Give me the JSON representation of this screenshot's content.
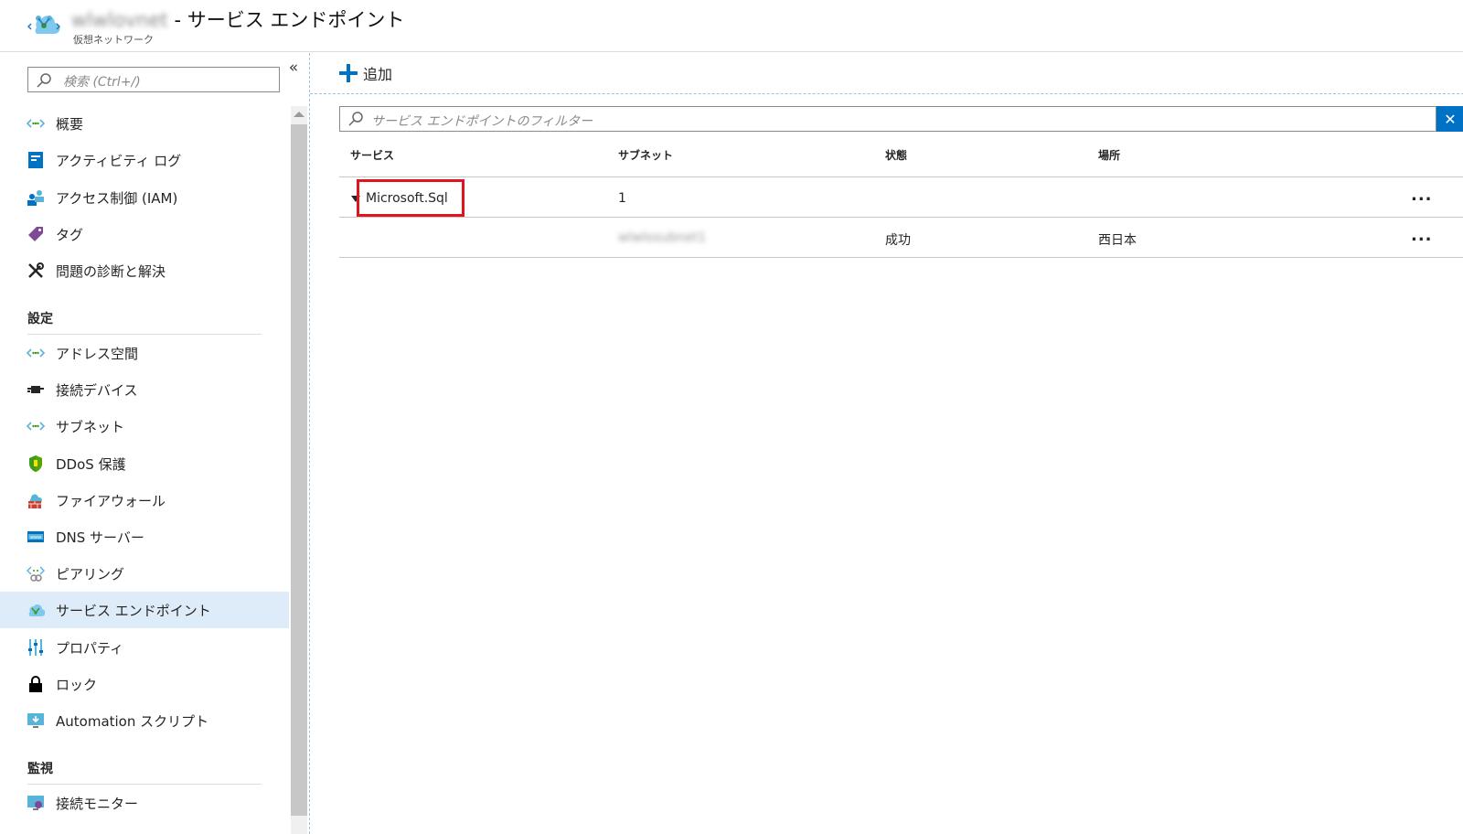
{
  "header": {
    "resource_name": "wlwlovnet",
    "separator": " - ",
    "page_title": "サービス エンドポイント",
    "subtitle": "仮想ネットワーク"
  },
  "sidebar": {
    "search_placeholder": "検索 (Ctrl+/)",
    "collapse_glyph": "«",
    "items_top": [
      {
        "label": "概要",
        "icon": "vnet-arrows-icon"
      },
      {
        "label": "アクティビティ ログ",
        "icon": "activity-log-icon"
      },
      {
        "label": "アクセス制御 (IAM)",
        "icon": "people-icon"
      },
      {
        "label": "タグ",
        "icon": "tag-icon"
      },
      {
        "label": "問題の診断と解決",
        "icon": "wrench-icon"
      }
    ],
    "section_settings": "設定",
    "items_settings": [
      {
        "label": "アドレス空間",
        "icon": "vnet-arrows-icon"
      },
      {
        "label": "接続デバイス",
        "icon": "plug-icon"
      },
      {
        "label": "サブネット",
        "icon": "vnet-arrows-icon"
      },
      {
        "label": "DDoS 保護",
        "icon": "shield-icon"
      },
      {
        "label": "ファイアウォール",
        "icon": "firewall-icon"
      },
      {
        "label": "DNS サーバー",
        "icon": "dns-icon"
      },
      {
        "label": "ピアリング",
        "icon": "peering-icon"
      },
      {
        "label": "サービス エンドポイント",
        "icon": "service-endpoint-icon",
        "active": true
      },
      {
        "label": "プロパティ",
        "icon": "properties-icon"
      },
      {
        "label": "ロック",
        "icon": "lock-icon"
      },
      {
        "label": "Automation スクリプト",
        "icon": "automation-icon"
      }
    ],
    "section_monitoring": "監視",
    "items_monitoring": [
      {
        "label": "接続モニター",
        "icon": "connection-monitor-icon"
      }
    ]
  },
  "main": {
    "add_label": "追加",
    "filter_placeholder": "サービス エンドポイントのフィルター",
    "clear_glyph": "✕",
    "columns": [
      "サービス",
      "サブネット",
      "状態",
      "場所"
    ],
    "rows": [
      {
        "service": "Microsoft.Sql",
        "subnet": "1",
        "status": "",
        "location": "",
        "more": "..."
      },
      {
        "service": "",
        "subnet": "wlwlosubnet1",
        "status": "成功",
        "location": "西日本",
        "more": "..."
      }
    ]
  },
  "colors": {
    "accent": "#0072c6",
    "active_bg": "#deecf9",
    "highlight": "#e0141e"
  }
}
